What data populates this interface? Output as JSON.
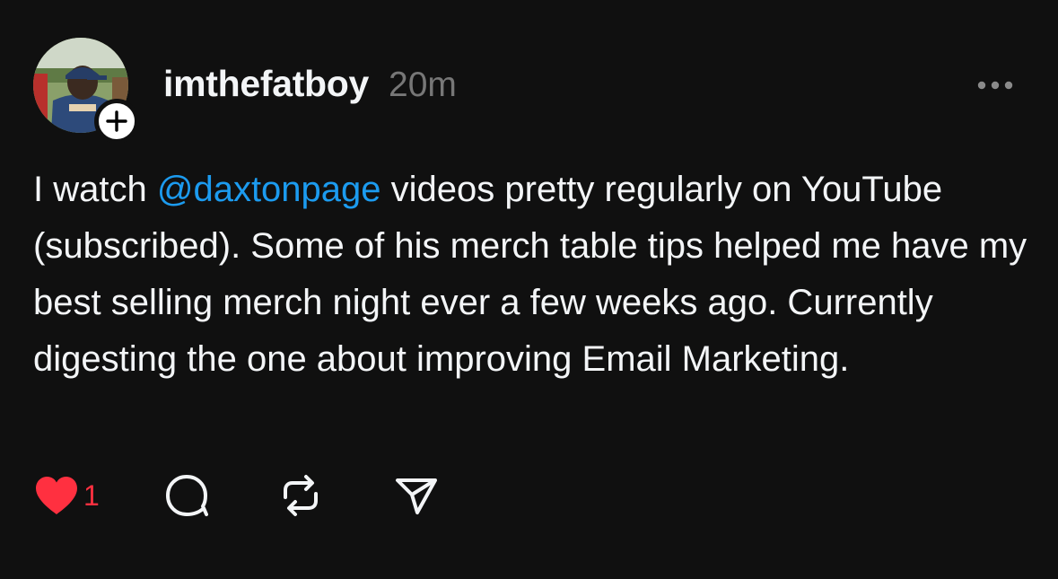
{
  "post": {
    "author": {
      "username": "imthefatboy",
      "avatar_icon": "profile-photo",
      "follow_icon": "plus-icon"
    },
    "timestamp": "20m",
    "more_icon": "more-dots-icon",
    "body": {
      "before_mention": "I watch ",
      "mention": "@daxtonpage",
      "after_mention": " videos pretty regularly on YouTube (subscribed). Some of his merch table tips helped me have my best selling merch night ever a few weeks ago. Currently digesting the one about improving Email Marketing."
    },
    "actions": {
      "like": {
        "icon": "heart-filled-icon",
        "count": "1",
        "liked": true
      },
      "reply": {
        "icon": "comment-icon"
      },
      "repost": {
        "icon": "repost-icon"
      },
      "share": {
        "icon": "send-icon"
      }
    }
  },
  "colors": {
    "background": "#101010",
    "text": "#f3f5f7",
    "secondary_text": "#777777",
    "mention": "#1c9bef",
    "like": "#ff3040"
  }
}
